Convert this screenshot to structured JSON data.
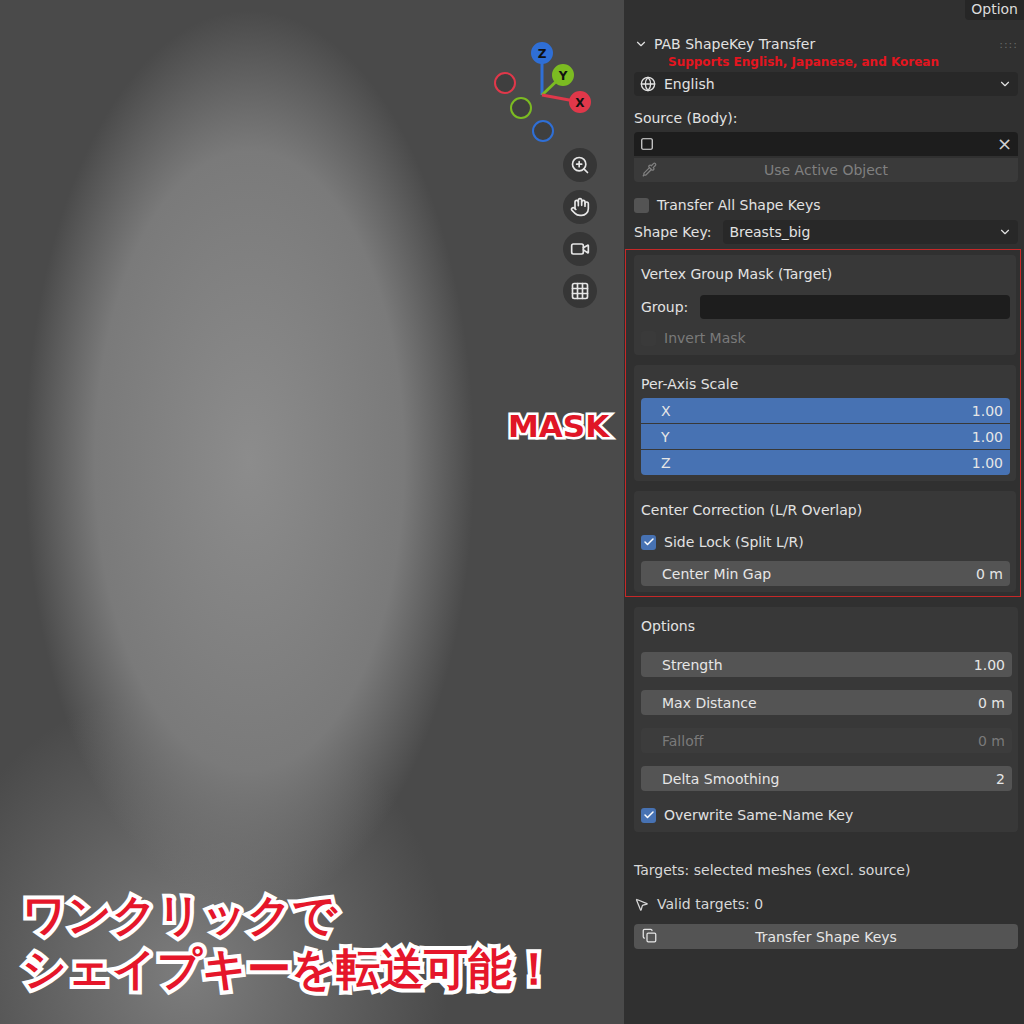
{
  "tab": "Option",
  "viewport": {
    "mask_label": "MASK",
    "caption": [
      "ワンクリックで",
      "シェイプキーを転送可能！"
    ],
    "gizmo": [
      {
        "label": "Z",
        "color": "#2f6fd6",
        "positive": true
      },
      {
        "label": "Y",
        "color": "#7cbb22",
        "positive": true
      },
      {
        "label": "X",
        "color": "#e0384a",
        "positive": true
      },
      {
        "label": "",
        "color": "#e0384a",
        "positive": false
      },
      {
        "label": "",
        "color": "#7cbb22",
        "positive": false
      },
      {
        "label": "",
        "color": "#2f6fd6",
        "positive": false
      }
    ]
  },
  "panel": {
    "title": "PAB ShapeKey Transfer",
    "expanded": true,
    "drag_handle": "::::",
    "note": "Supports English, Japanese, and Korean",
    "language": "English",
    "source_label": "Source (Body):",
    "source_value": "",
    "clear": "×",
    "use_active": {
      "label": "Use Active Object",
      "disabled": true
    },
    "transfer_all": {
      "label": "Transfer All Shape Keys",
      "checked": false
    },
    "shape_key": {
      "label": "Shape Key:",
      "value": "Breasts_big"
    }
  },
  "mask_sections": [
    {
      "title": "Vertex Group Mask (Target)",
      "rows": [
        {
          "kind": "text",
          "label": "Group:",
          "value": "",
          "disabled": false
        },
        {
          "kind": "checkbox",
          "label": "Invert Mask",
          "checked": false,
          "disabled": true
        }
      ]
    },
    {
      "title": "Per-Axis Scale",
      "rows": [
        {
          "kind": "axis",
          "label": "X",
          "value": "1.00",
          "disabled": false
        },
        {
          "kind": "axis",
          "label": "Y",
          "value": "1.00",
          "disabled": false
        },
        {
          "kind": "axis",
          "label": "Z",
          "value": "1.00",
          "disabled": false
        }
      ]
    },
    {
      "title": "Center Correction (L/R Overlap)",
      "rows": [
        {
          "kind": "checkbox",
          "label": "Side Lock (Split L/R)",
          "checked": true,
          "disabled": false
        },
        {
          "kind": "number",
          "label": "Center Min Gap",
          "value": "0 m",
          "disabled": false
        }
      ]
    }
  ],
  "options": {
    "title": "Options",
    "rows": [
      {
        "kind": "number",
        "label": "Strength",
        "value": "1.00",
        "disabled": false
      },
      {
        "kind": "number",
        "label": "Max Distance",
        "value": "0 m",
        "disabled": false
      },
      {
        "kind": "number",
        "label": "Falloff",
        "value": "0 m",
        "disabled": true
      },
      {
        "kind": "number",
        "label": "Delta Smoothing",
        "value": "2",
        "disabled": false
      },
      {
        "kind": "checkbox",
        "label": "Overwrite Same-Name Key",
        "checked": true,
        "disabled": false
      }
    ]
  },
  "targets_note": "Targets: selected meshes (excl. source)",
  "valid_targets": "Valid targets: 0",
  "transfer_button": "Transfer Shape Keys"
}
